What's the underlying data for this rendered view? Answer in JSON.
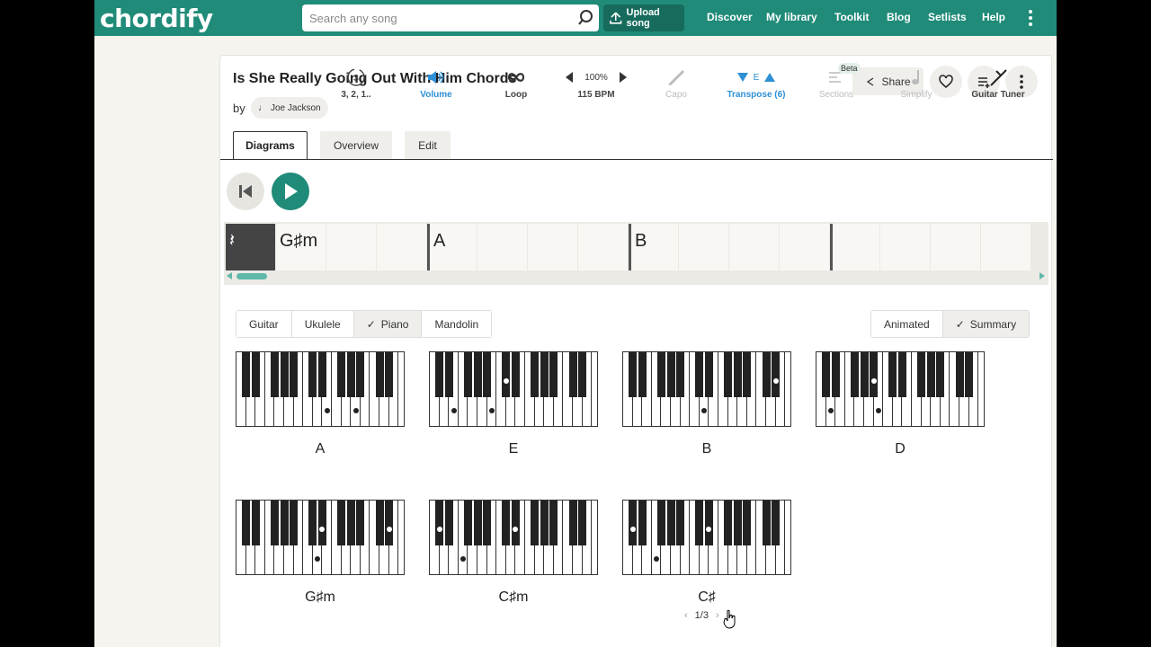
{
  "header": {
    "logo": "chordify",
    "search_placeholder": "Search any song",
    "upload_label": "Upload song",
    "nav": [
      "Discover",
      "My library",
      "Toolkit",
      "Blog",
      "Setlists",
      "Help"
    ]
  },
  "song": {
    "title": "Is She Really Going Out With Him Chords",
    "by": "by",
    "artist": "Joe Jackson",
    "share_label": "Share"
  },
  "tabs": [
    "Diagrams",
    "Overview",
    "Edit"
  ],
  "controls": {
    "countdown_label": "3, 2, 1..",
    "countdown_number": "3",
    "volume_label": "Volume",
    "loop_label": "Loop",
    "tempo_percent": "100%",
    "tempo_bpm": "115 BPM",
    "capo_label": "Capo",
    "transpose_key": "E",
    "transpose_label": "Transpose (6)",
    "sections_label": "Sections",
    "sections_badge": "Beta",
    "simplify_label": "Simplify",
    "tuner_label": "Guitar Tuner"
  },
  "timeline": {
    "beats": [
      "𝄽",
      "G♯m",
      "",
      "",
      "A",
      "",
      "",
      "",
      "B",
      "",
      "",
      "",
      "",
      "",
      "",
      ""
    ]
  },
  "instruments": [
    "Guitar",
    "Ukulele",
    "Piano",
    "Mandolin"
  ],
  "selected_instrument": "Piano",
  "views": [
    "Animated",
    "Summary"
  ],
  "selected_view": "Summary",
  "chords": [
    "A",
    "E",
    "B",
    "D",
    "G♯m",
    "C♯m",
    "C♯"
  ],
  "pager": "1/3",
  "colors": {
    "brand": "#1f8b78",
    "blue": "#2d8fd5"
  }
}
